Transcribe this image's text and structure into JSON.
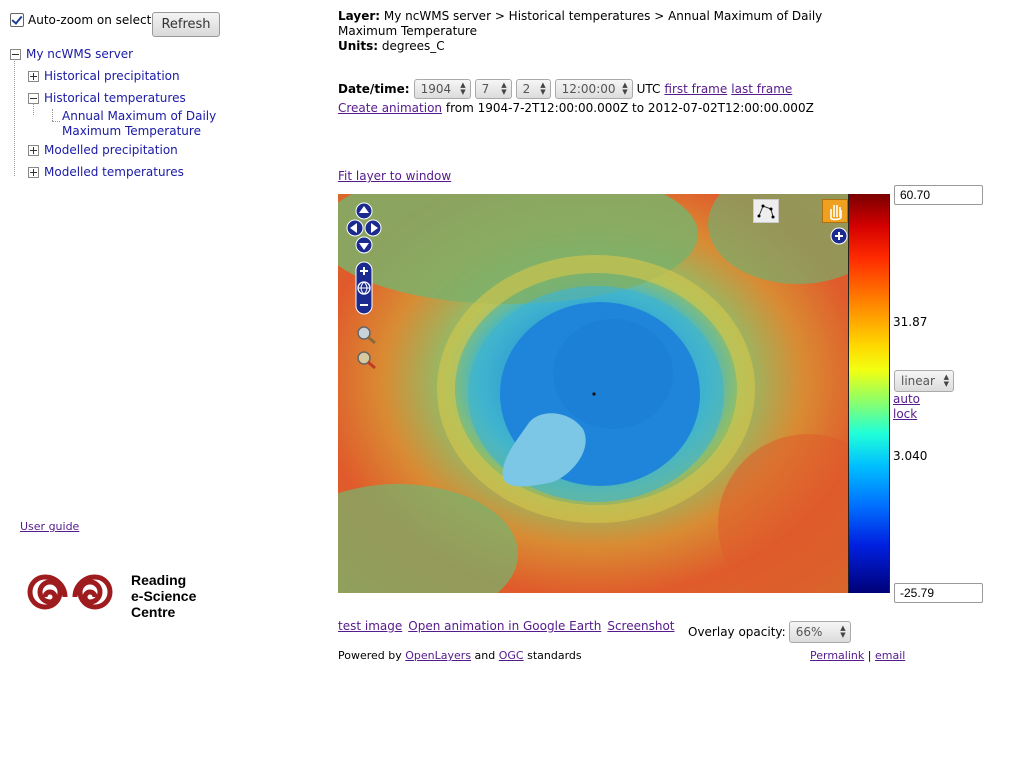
{
  "left": {
    "autozoom_label": "Auto-zoom on select",
    "refresh_label": "Refresh",
    "tree": {
      "root": "My ncWMS server",
      "items": [
        {
          "label": "Historical precipitation",
          "state": "collapsed"
        },
        {
          "label": "Historical temperatures",
          "state": "expanded"
        },
        {
          "label": "Annual Maximum of Daily Maximum Temperature",
          "state": "leaf"
        },
        {
          "label": "Modelled precipitation",
          "state": "collapsed"
        },
        {
          "label": "Modelled temperatures",
          "state": "collapsed"
        }
      ]
    },
    "user_guide": "User guide",
    "logo_text": [
      "Reading",
      "e-Science",
      "Centre"
    ],
    "logo_colour": "#9e1b1e"
  },
  "layer": {
    "layer_label": "Layer:",
    "layer_path": "My ncWMS server > Historical temperatures > Annual Maximum of Daily Maximum Temperature",
    "units_label": "Units:",
    "units": "degrees_C"
  },
  "datetime": {
    "label": "Date/time:",
    "year": "1904",
    "month": "7",
    "day": "2",
    "time": "12:00:00",
    "tz": "UTC",
    "first_frame": "first frame",
    "last_frame": "last frame",
    "create_animation": "Create animation",
    "range_text": "from 1904-7-2T12:00:00.000Z to 2012-07-02T12:00:00.000Z"
  },
  "fit_layer": "Fit layer to window",
  "colour_scale": {
    "max": "60.70",
    "mid_high": "31.87",
    "mid_low": "3.040",
    "min": "-25.79",
    "scale_type": "linear",
    "auto": "auto",
    "lock": "lock"
  },
  "bottom": {
    "test_image": "test image",
    "open_ge": "Open animation in Google Earth",
    "screenshot": "Screenshot",
    "opacity_label": "Overlay opacity:",
    "opacity_value": "66%",
    "powered_by": "Powered by",
    "openlayers": "OpenLayers",
    "and": "and",
    "ogc": "OGC",
    "standards": "standards",
    "permalink": "Permalink",
    "sep": "|",
    "email": "email"
  },
  "icons": {
    "pan": "pan-arrows-icon",
    "zoom_in": "zoom-in-icon",
    "world": "world-icon",
    "zoom_out": "zoom-out-icon",
    "draw": "draw-path-icon",
    "hand": "hand-pan-icon",
    "layer_switcher": "layer-switcher-plus-icon"
  }
}
